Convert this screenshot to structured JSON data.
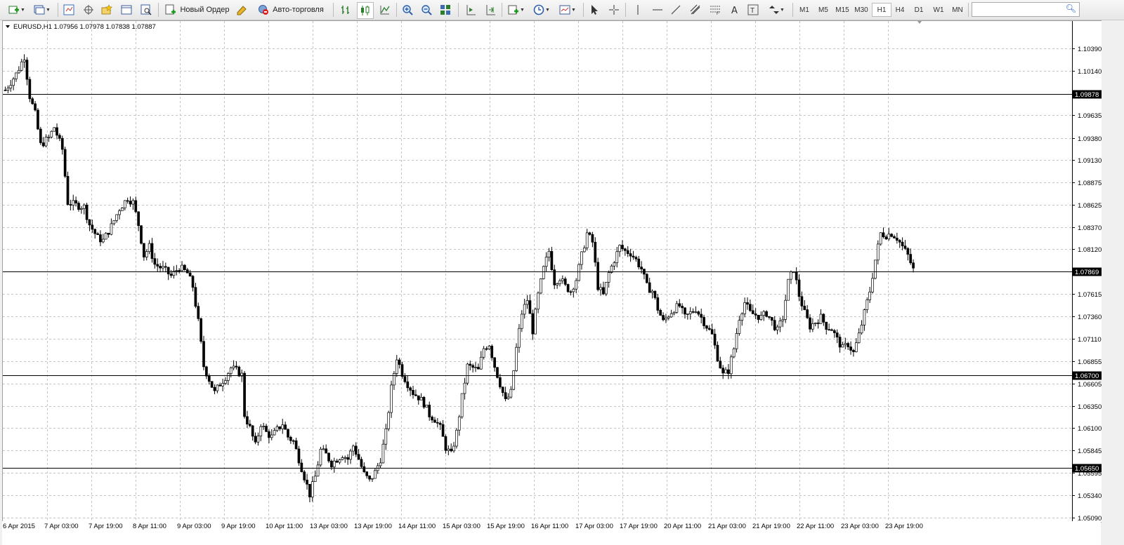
{
  "toolbar": {
    "new_order_label": "Новый Ордер",
    "auto_trading_label": "Авто-торговля",
    "timeframes": [
      "M1",
      "M5",
      "M15",
      "M30",
      "H1",
      "H4",
      "D1",
      "W1",
      "MN"
    ],
    "active_timeframe": "H1",
    "search_placeholder": ""
  },
  "chart": {
    "symbol_info": "EURUSD,H1  1.07956 1.07978 1.07838 1.07887",
    "price_levels": [
      {
        "label": "1.09878",
        "value": 1.09878
      },
      {
        "label": "1.07869",
        "value": 1.07869
      },
      {
        "label": "1.06700",
        "value": 1.067
      },
      {
        "label": "1.05650",
        "value": 1.0565
      }
    ]
  },
  "chart_data": {
    "type": "candlestick",
    "y_ticks": [
      "1.10390",
      "1.10140",
      "1.09635",
      "1.09380",
      "1.09130",
      "1.08875",
      "1.08625",
      "1.08370",
      "1.08120",
      "1.07615",
      "1.07360",
      "1.07110",
      "1.06855",
      "1.06605",
      "1.06350",
      "1.06100",
      "1.05845",
      "1.05595",
      "1.05340",
      "1.05090"
    ],
    "ylim": [
      1.0504,
      1.107
    ],
    "x_ticks": [
      "6 Apr 2015",
      "7 Apr 03:00",
      "7 Apr 19:00",
      "8 Apr 11:00",
      "9 Apr 03:00",
      "9 Apr 19:00",
      "10 Apr 11:00",
      "13 Apr 03:00",
      "13 Apr 19:00",
      "14 Apr 11:00",
      "15 Apr 03:00",
      "15 Apr 19:00",
      "16 Apr 11:00",
      "17 Apr 03:00",
      "17 Apr 19:00",
      "20 Apr 11:00",
      "21 Apr 03:00",
      "21 Apr 19:00",
      "22 Apr 11:00",
      "23 Apr 03:00",
      "23 Apr 19:00"
    ],
    "close_path": [
      [
        0,
        1.0992
      ],
      [
        4,
        1.101
      ],
      [
        7,
        1.103
      ],
      [
        9,
        1.0985
      ],
      [
        11,
        1.0965
      ],
      [
        13,
        1.093
      ],
      [
        16,
        1.0938
      ],
      [
        18,
        1.095
      ],
      [
        21,
        1.0925
      ],
      [
        23,
        1.0865
      ],
      [
        26,
        1.0862
      ],
      [
        29,
        1.086
      ],
      [
        31,
        1.084
      ],
      [
        34,
        1.0825
      ],
      [
        36,
        1.0822
      ],
      [
        39,
        1.0838
      ],
      [
        42,
        1.0858
      ],
      [
        45,
        1.087
      ],
      [
        47,
        1.0865
      ],
      [
        49,
        1.084
      ],
      [
        51,
        1.0805
      ],
      [
        53,
        1.0815
      ],
      [
        55,
        1.0795
      ],
      [
        58,
        1.079
      ],
      [
        61,
        1.0782
      ],
      [
        64,
        1.0792
      ],
      [
        67,
        1.0785
      ],
      [
        69,
        1.077
      ],
      [
        71,
        1.073
      ],
      [
        73,
        1.068
      ],
      [
        75,
        1.0665
      ],
      [
        77,
        1.065
      ],
      [
        79,
        1.066
      ],
      [
        81,
        1.0668
      ],
      [
        83,
        1.0678
      ],
      [
        85,
        1.0675
      ],
      [
        87,
        1.067
      ],
      [
        88,
        1.0625
      ],
      [
        90,
        1.061
      ],
      [
        92,
        1.059
      ],
      [
        94,
        1.0615
      ],
      [
        96,
        1.0605
      ],
      [
        98,
        1.06
      ],
      [
        100,
        1.0608
      ],
      [
        102,
        1.0615
      ],
      [
        104,
        1.06
      ],
      [
        106,
        1.0595
      ],
      [
        108,
        1.0575
      ],
      [
        110,
        1.0555
      ],
      [
        112,
        1.0535
      ],
      [
        114,
        1.0555
      ],
      [
        116,
        1.0585
      ],
      [
        118,
        1.058
      ],
      [
        120,
        1.057
      ],
      [
        122,
        1.0575
      ],
      [
        124,
        1.058
      ],
      [
        126,
        1.0575
      ],
      [
        128,
        1.059
      ],
      [
        130,
        1.0575
      ],
      [
        132,
        1.0558
      ],
      [
        134,
        1.055
      ],
      [
        136,
        1.056
      ],
      [
        138,
        1.0575
      ],
      [
        140,
        1.0605
      ],
      [
        142,
        1.0655
      ],
      [
        144,
        1.069
      ],
      [
        146,
        1.0672
      ],
      [
        148,
        1.066
      ],
      [
        150,
        1.065
      ],
      [
        152,
        1.0645
      ],
      [
        154,
        1.0638
      ],
      [
        156,
        1.0625
      ],
      [
        158,
        1.062
      ],
      [
        160,
        1.061
      ],
      [
        162,
        1.0588
      ],
      [
        164,
        1.058
      ],
      [
        166,
        1.0605
      ],
      [
        168,
        1.0645
      ],
      [
        170,
        1.068
      ],
      [
        172,
        1.0678
      ],
      [
        174,
        1.0675
      ],
      [
        176,
        1.07
      ],
      [
        178,
        1.0705
      ],
      [
        180,
        1.068
      ],
      [
        182,
        1.066
      ],
      [
        184,
        1.064
      ],
      [
        186,
        1.065
      ],
      [
        188,
        1.07
      ],
      [
        190,
        1.074
      ],
      [
        192,
        1.0755
      ],
      [
        194,
        1.072
      ],
      [
        196,
        1.076
      ],
      [
        198,
        1.079
      ],
      [
        200,
        1.081
      ],
      [
        202,
        1.0775
      ],
      [
        204,
        1.078
      ],
      [
        206,
        1.077
      ],
      [
        208,
        1.0765
      ],
      [
        210,
        1.0778
      ],
      [
        212,
        1.0805
      ],
      [
        214,
        1.083
      ],
      [
        216,
        1.082
      ],
      [
        218,
        1.077
      ],
      [
        220,
        1.076
      ],
      [
        222,
        1.0785
      ],
      [
        224,
        1.08
      ],
      [
        226,
        1.0815
      ],
      [
        228,
        1.081
      ],
      [
        230,
        1.0808
      ],
      [
        232,
        1.08
      ],
      [
        234,
        1.079
      ],
      [
        236,
        1.077
      ],
      [
        238,
        1.0765
      ],
      [
        240,
        1.0745
      ],
      [
        242,
        1.073
      ],
      [
        244,
        1.0738
      ],
      [
        246,
        1.0745
      ],
      [
        248,
        1.0748
      ],
      [
        250,
        1.0735
      ],
      [
        252,
        1.074
      ],
      [
        254,
        1.0745
      ],
      [
        256,
        1.0735
      ],
      [
        258,
        1.0725
      ],
      [
        260,
        1.0715
      ],
      [
        262,
        1.069
      ],
      [
        264,
        1.067
      ],
      [
        266,
        1.0675
      ],
      [
        268,
        1.07
      ],
      [
        270,
        1.0735
      ],
      [
        272,
        1.0752
      ],
      [
        274,
        1.074
      ],
      [
        276,
        1.0738
      ],
      [
        278,
        1.0735
      ],
      [
        280,
        1.074
      ],
      [
        282,
        1.073
      ],
      [
        284,
        1.072
      ],
      [
        286,
        1.0735
      ],
      [
        288,
        1.0775
      ],
      [
        290,
        1.079
      ],
      [
        292,
        1.076
      ],
      [
        294,
        1.074
      ],
      [
        296,
        1.0725
      ],
      [
        298,
        1.073
      ],
      [
        300,
        1.0735
      ],
      [
        302,
        1.0725
      ],
      [
        304,
        1.0722
      ],
      [
        306,
        1.071
      ],
      [
        308,
        1.07
      ],
      [
        310,
        1.0705
      ],
      [
        312,
        1.0695
      ],
      [
        314,
        1.0715
      ],
      [
        316,
        1.074
      ],
      [
        318,
        1.0765
      ],
      [
        320,
        1.08
      ],
      [
        322,
        1.083
      ],
      [
        324,
        1.0828
      ],
      [
        326,
        1.083
      ],
      [
        328,
        1.0825
      ],
      [
        330,
        1.0815
      ],
      [
        332,
        1.0805
      ],
      [
        334,
        1.0789
      ]
    ]
  },
  "colors": {
    "chart_bg": "#ffffff",
    "grid": "#c4c4c4",
    "candle": "#000000",
    "level_label_bg": "#000000",
    "level_label_fg": "#ffffff"
  }
}
